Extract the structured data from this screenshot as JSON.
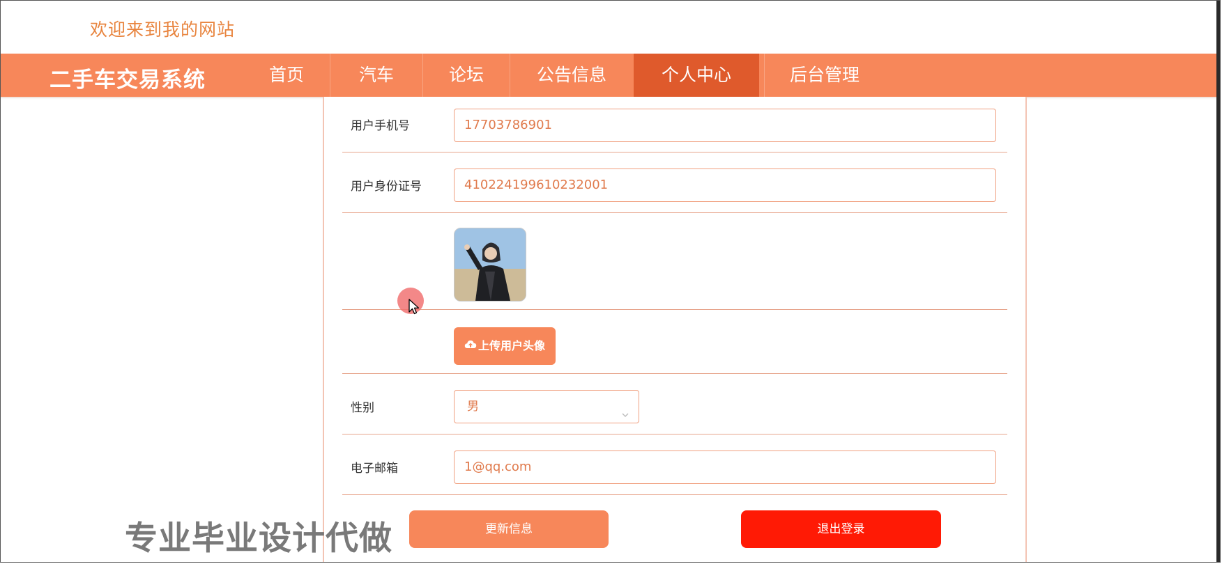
{
  "header": {
    "welcome_text": "欢迎来到我的网站"
  },
  "nav": {
    "logo": "二手车交易系统",
    "items": [
      {
        "label": "首页"
      },
      {
        "label": "汽车"
      },
      {
        "label": "论坛"
      },
      {
        "label": "公告信息"
      },
      {
        "label": "个人中心",
        "active": true
      },
      {
        "label": "后台管理"
      }
    ]
  },
  "form": {
    "phone": {
      "label": "用户手机号",
      "value": "17703786901"
    },
    "id_number": {
      "label": "用户身份证号",
      "value": "410224199610232001"
    },
    "avatar": {
      "icon": "user-avatar-photo"
    },
    "upload_button": "上传用户头像",
    "gender": {
      "label": "性别",
      "value": "男"
    },
    "email": {
      "label": "电子邮箱",
      "value": "1@qq.com"
    }
  },
  "actions": {
    "update_label": "更新信息",
    "logout_label": "退出登录"
  },
  "watermark": "专业毕业设计代做",
  "colors": {
    "nav_bg": "#f7875a",
    "nav_active": "#df5a2c",
    "welcome_text": "#e8843e",
    "input_text": "#e07a4c",
    "logout_btn": "#ff1a05"
  }
}
